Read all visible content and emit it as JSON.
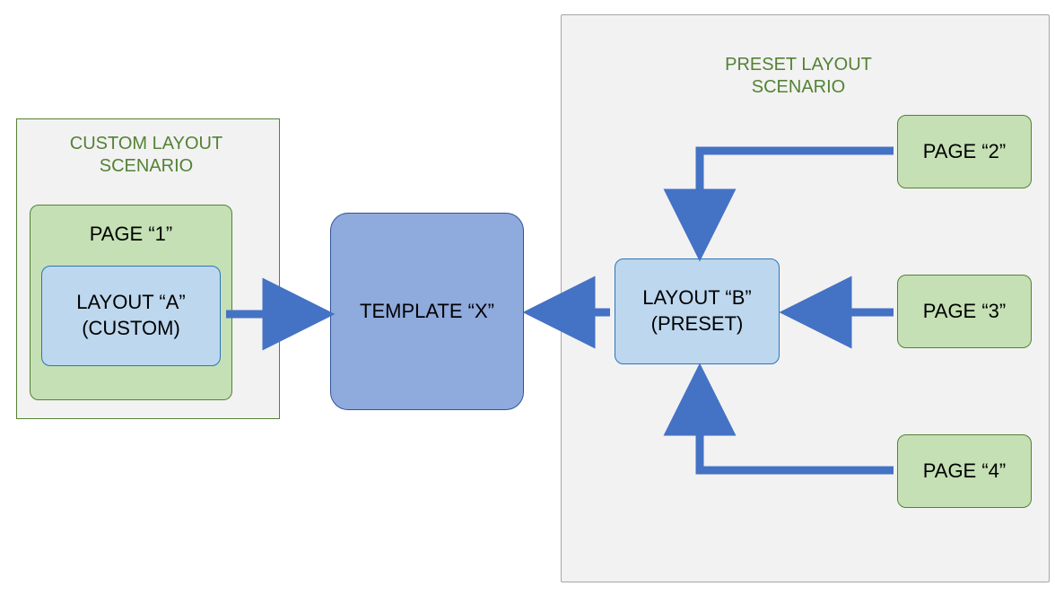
{
  "titles": {
    "custom": "CUSTOM LAYOUT SCENARIO",
    "preset": "PRESET LAYOUT SCENARIO"
  },
  "boxes": {
    "page1": "PAGE “1”",
    "layoutA_line1": "LAYOUT “A”",
    "layoutA_line2": "(CUSTOM)",
    "templateX": "TEMPLATE “X”",
    "layoutB_line1": "LAYOUT “B”",
    "layoutB_line2": "(PRESET)",
    "page2": "PAGE “2”",
    "page3": "PAGE “3”",
    "page4": "PAGE “4”"
  },
  "colors": {
    "arrow": "#4472c4",
    "panelBorder": "#a6a6a6",
    "greenBorder": "#548235",
    "greenFill": "#c5e0b4",
    "blueFill": "#bdd7ee",
    "blueBorder": "#2e75b6",
    "templateFill": "#8faadc",
    "templateBorder": "#2f5597",
    "titleText": "#548235"
  }
}
